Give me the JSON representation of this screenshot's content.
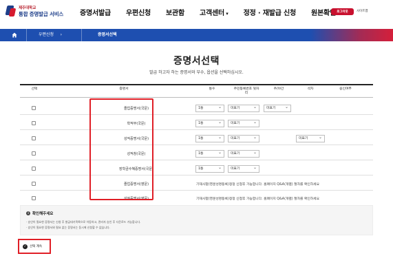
{
  "header": {
    "logo_univ": "제주대학교",
    "logo_title": "통합 증명발급 서비스",
    "nav": [
      "증명서발급",
      "우편신청",
      "보관함",
      "고객센터",
      "정정 · 재발급 신청",
      "원본확인"
    ],
    "login_label": "로그아웃",
    "sitemap_label": "사이트맵"
  },
  "breadcrumb": {
    "home_icon": "home-icon",
    "items": [
      "우편신청",
      "증명서선택"
    ]
  },
  "page": {
    "title": "증명서선택",
    "description": "발급 하고자 하는 증명서와 부수, 옵션을 선택하십시오."
  },
  "table": {
    "headers": [
      "선택",
      "증명서",
      "통수",
      "주민등록번호 뒷자리",
      "주/야간",
      "석차",
      "승인여부"
    ],
    "rows": [
      {
        "cert": "졸업증명서(국문)",
        "copies": "1통",
        "ssn": "미표기",
        "daynight": "미표기",
        "rank": "",
        "notice": ""
      },
      {
        "cert": "학적부(국문)",
        "copies": "1통",
        "ssn": "미표기",
        "daynight": "",
        "rank": "",
        "notice": ""
      },
      {
        "cert": "성적증명서(국문)",
        "copies": "1통",
        "ssn": "미표기",
        "daynight": "",
        "rank": "미표기",
        "notice": ""
      },
      {
        "cert": "성적창(국문)",
        "copies": "1통",
        "ssn": "미표기",
        "daynight": "",
        "rank": "",
        "notice": ""
      },
      {
        "cert": "장학금수혜증명서(국문)",
        "copies": "1통",
        "ssn": "미표기",
        "daynight": "",
        "rank": "",
        "notice": ""
      },
      {
        "cert": "졸업증명서(영문)",
        "copies": "",
        "ssn": "",
        "daynight": "",
        "rank": "",
        "notice": "기재사항(영문성명등록)정정 신청후 가능합니다. 홈페이지 Q&A(개별) 절차를 확인하세요"
      },
      {
        "cert": "성적증명서(영문)",
        "copies": "",
        "ssn": "",
        "daynight": "",
        "rank": "",
        "notice": "기재사항(영문성명등록)정정 신청후 가능합니다. 홈페이지 Q&A(개별) 절차를 확인하세요"
      }
    ]
  },
  "info": {
    "title": "확인해주세요",
    "lines": [
      "· 승인이 필요한 증명서는 신청 후 발급대기목록으로 이동하고, 관리자 승인 후 다운로드 가능합니다.",
      "· 승인이 필요한 증명서와 필요 없는 증명서는 동시에 신청할 수 없습니다."
    ]
  },
  "action": {
    "next_label": "선택 계속"
  },
  "colors": {
    "brand_blue": "#1e4fb0",
    "brand_red": "#d51f3a",
    "highlight": "#e01e26"
  }
}
